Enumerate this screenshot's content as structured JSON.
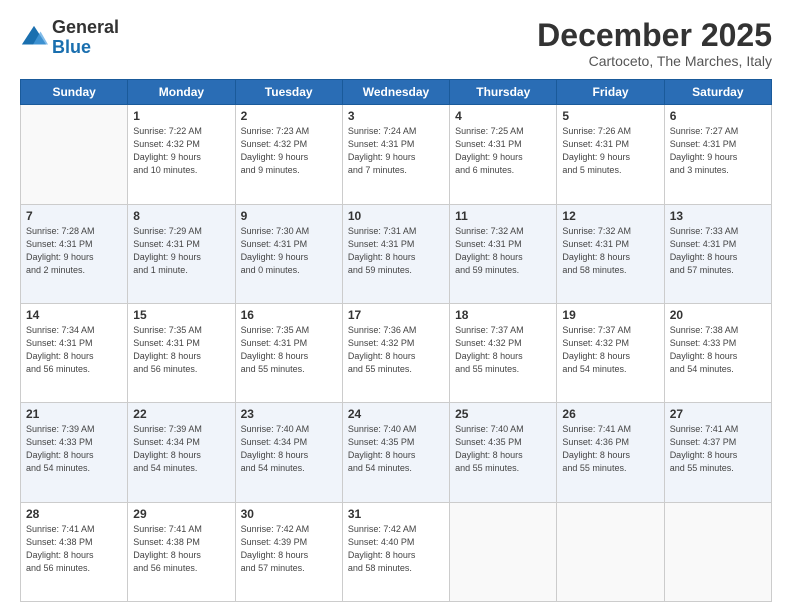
{
  "header": {
    "logo_general": "General",
    "logo_blue": "Blue",
    "month_title": "December 2025",
    "subtitle": "Cartoceto, The Marches, Italy"
  },
  "days_of_week": [
    "Sunday",
    "Monday",
    "Tuesday",
    "Wednesday",
    "Thursday",
    "Friday",
    "Saturday"
  ],
  "weeks": [
    [
      {
        "day": "",
        "text": ""
      },
      {
        "day": "1",
        "text": "Sunrise: 7:22 AM\nSunset: 4:32 PM\nDaylight: 9 hours\nand 10 minutes."
      },
      {
        "day": "2",
        "text": "Sunrise: 7:23 AM\nSunset: 4:32 PM\nDaylight: 9 hours\nand 9 minutes."
      },
      {
        "day": "3",
        "text": "Sunrise: 7:24 AM\nSunset: 4:31 PM\nDaylight: 9 hours\nand 7 minutes."
      },
      {
        "day": "4",
        "text": "Sunrise: 7:25 AM\nSunset: 4:31 PM\nDaylight: 9 hours\nand 6 minutes."
      },
      {
        "day": "5",
        "text": "Sunrise: 7:26 AM\nSunset: 4:31 PM\nDaylight: 9 hours\nand 5 minutes."
      },
      {
        "day": "6",
        "text": "Sunrise: 7:27 AM\nSunset: 4:31 PM\nDaylight: 9 hours\nand 3 minutes."
      }
    ],
    [
      {
        "day": "7",
        "text": "Sunrise: 7:28 AM\nSunset: 4:31 PM\nDaylight: 9 hours\nand 2 minutes."
      },
      {
        "day": "8",
        "text": "Sunrise: 7:29 AM\nSunset: 4:31 PM\nDaylight: 9 hours\nand 1 minute."
      },
      {
        "day": "9",
        "text": "Sunrise: 7:30 AM\nSunset: 4:31 PM\nDaylight: 9 hours\nand 0 minutes."
      },
      {
        "day": "10",
        "text": "Sunrise: 7:31 AM\nSunset: 4:31 PM\nDaylight: 8 hours\nand 59 minutes."
      },
      {
        "day": "11",
        "text": "Sunrise: 7:32 AM\nSunset: 4:31 PM\nDaylight: 8 hours\nand 59 minutes."
      },
      {
        "day": "12",
        "text": "Sunrise: 7:32 AM\nSunset: 4:31 PM\nDaylight: 8 hours\nand 58 minutes."
      },
      {
        "day": "13",
        "text": "Sunrise: 7:33 AM\nSunset: 4:31 PM\nDaylight: 8 hours\nand 57 minutes."
      }
    ],
    [
      {
        "day": "14",
        "text": "Sunrise: 7:34 AM\nSunset: 4:31 PM\nDaylight: 8 hours\nand 56 minutes."
      },
      {
        "day": "15",
        "text": "Sunrise: 7:35 AM\nSunset: 4:31 PM\nDaylight: 8 hours\nand 56 minutes."
      },
      {
        "day": "16",
        "text": "Sunrise: 7:35 AM\nSunset: 4:31 PM\nDaylight: 8 hours\nand 55 minutes."
      },
      {
        "day": "17",
        "text": "Sunrise: 7:36 AM\nSunset: 4:32 PM\nDaylight: 8 hours\nand 55 minutes."
      },
      {
        "day": "18",
        "text": "Sunrise: 7:37 AM\nSunset: 4:32 PM\nDaylight: 8 hours\nand 55 minutes."
      },
      {
        "day": "19",
        "text": "Sunrise: 7:37 AM\nSunset: 4:32 PM\nDaylight: 8 hours\nand 54 minutes."
      },
      {
        "day": "20",
        "text": "Sunrise: 7:38 AM\nSunset: 4:33 PM\nDaylight: 8 hours\nand 54 minutes."
      }
    ],
    [
      {
        "day": "21",
        "text": "Sunrise: 7:39 AM\nSunset: 4:33 PM\nDaylight: 8 hours\nand 54 minutes."
      },
      {
        "day": "22",
        "text": "Sunrise: 7:39 AM\nSunset: 4:34 PM\nDaylight: 8 hours\nand 54 minutes."
      },
      {
        "day": "23",
        "text": "Sunrise: 7:40 AM\nSunset: 4:34 PM\nDaylight: 8 hours\nand 54 minutes."
      },
      {
        "day": "24",
        "text": "Sunrise: 7:40 AM\nSunset: 4:35 PM\nDaylight: 8 hours\nand 54 minutes."
      },
      {
        "day": "25",
        "text": "Sunrise: 7:40 AM\nSunset: 4:35 PM\nDaylight: 8 hours\nand 55 minutes."
      },
      {
        "day": "26",
        "text": "Sunrise: 7:41 AM\nSunset: 4:36 PM\nDaylight: 8 hours\nand 55 minutes."
      },
      {
        "day": "27",
        "text": "Sunrise: 7:41 AM\nSunset: 4:37 PM\nDaylight: 8 hours\nand 55 minutes."
      }
    ],
    [
      {
        "day": "28",
        "text": "Sunrise: 7:41 AM\nSunset: 4:38 PM\nDaylight: 8 hours\nand 56 minutes."
      },
      {
        "day": "29",
        "text": "Sunrise: 7:41 AM\nSunset: 4:38 PM\nDaylight: 8 hours\nand 56 minutes."
      },
      {
        "day": "30",
        "text": "Sunrise: 7:42 AM\nSunset: 4:39 PM\nDaylight: 8 hours\nand 57 minutes."
      },
      {
        "day": "31",
        "text": "Sunrise: 7:42 AM\nSunset: 4:40 PM\nDaylight: 8 hours\nand 58 minutes."
      },
      {
        "day": "",
        "text": ""
      },
      {
        "day": "",
        "text": ""
      },
      {
        "day": "",
        "text": ""
      }
    ]
  ]
}
